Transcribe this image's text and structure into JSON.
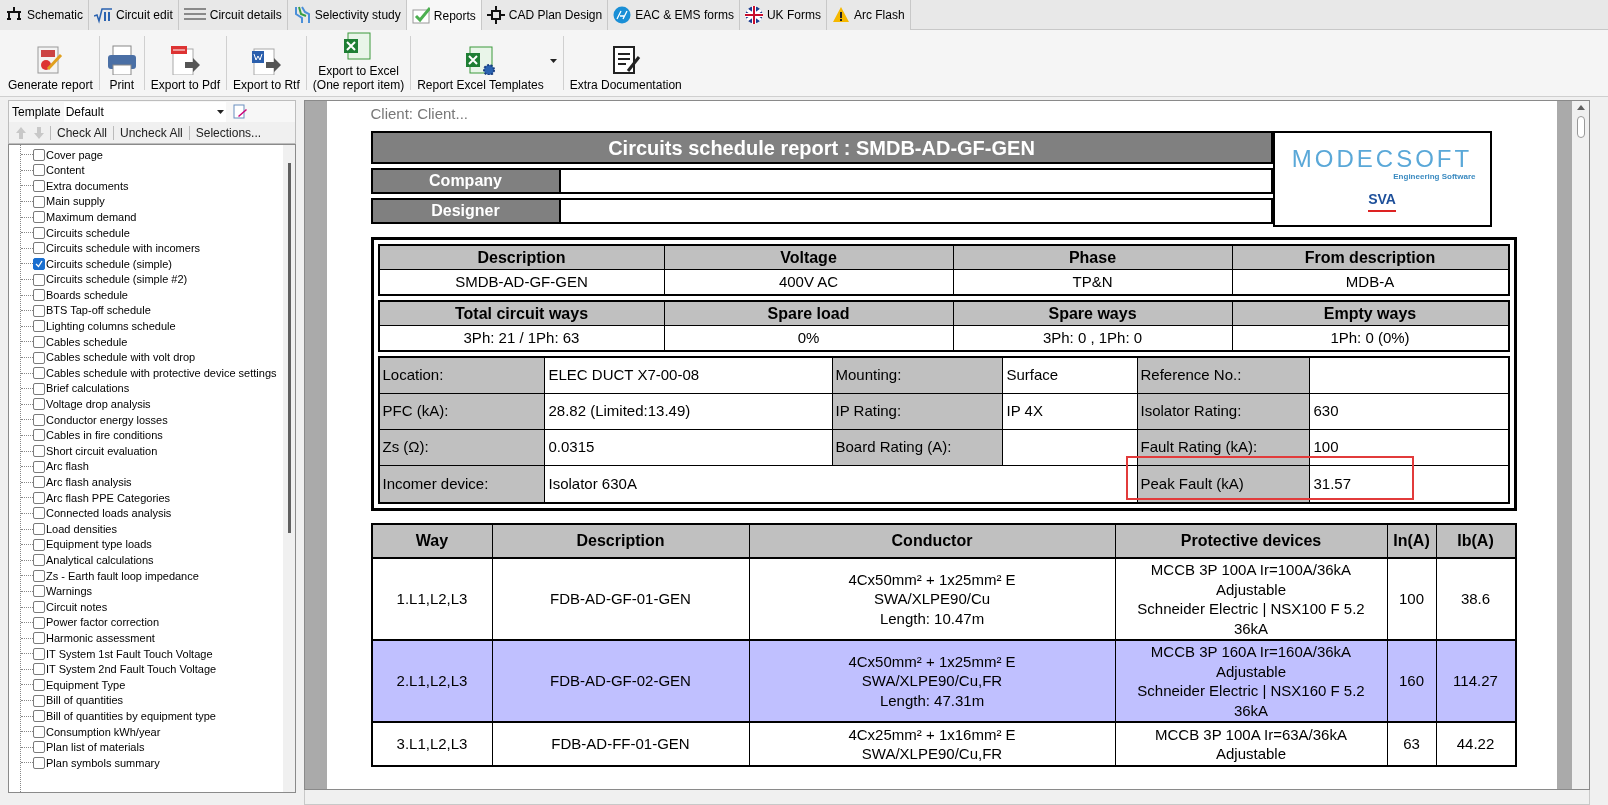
{
  "tabs": [
    {
      "label": "Schematic",
      "kind": "schematic",
      "selected": false
    },
    {
      "label": "Circuit edit",
      "kind": "formula",
      "selected": false
    },
    {
      "label": "Circuit details",
      "kind": "lines",
      "selected": false
    },
    {
      "label": "Selectivity study",
      "kind": "curves",
      "selected": false
    },
    {
      "label": "Reports",
      "kind": "check",
      "selected": true
    },
    {
      "label": "CAD Plan Design",
      "kind": "crosshair",
      "selected": false
    },
    {
      "label": "EAC & EMS forms",
      "kind": "badge",
      "selected": false
    },
    {
      "label": "UK Forms",
      "kind": "flag",
      "selected": false
    },
    {
      "label": "Arc Flash",
      "kind": "warning",
      "selected": false
    }
  ],
  "toolbar": [
    {
      "label": "Generate report",
      "kind": "report"
    },
    {
      "label": "Print",
      "kind": "print"
    },
    {
      "label": "Export to Pdf",
      "kind": "pdf"
    },
    {
      "label": "Export to Rtf",
      "kind": "rtf"
    },
    {
      "label": "Export to Excel\n(One report item)",
      "kind": "excel"
    },
    {
      "label": "Report Excel Templates",
      "kind": "excel-gear",
      "dropdown": true
    },
    {
      "label": "Extra Documentation",
      "kind": "document"
    }
  ],
  "sidebar": {
    "template_label": "Template",
    "template_value": "Default",
    "actions": [
      "Check All",
      "Uncheck All",
      "Selections..."
    ],
    "items": [
      {
        "label": "Cover page",
        "checked": false
      },
      {
        "label": "Content",
        "checked": false
      },
      {
        "label": "Extra documents",
        "checked": false
      },
      {
        "label": "Main supply",
        "checked": false
      },
      {
        "label": "Maximum demand",
        "checked": false
      },
      {
        "label": "Circuits schedule",
        "checked": false
      },
      {
        "label": "Circuits schedule with incomers",
        "checked": false
      },
      {
        "label": "Circuits schedule (simple)",
        "checked": true
      },
      {
        "label": "Circuits schedule (simple #2)",
        "checked": false
      },
      {
        "label": "Boards schedule",
        "checked": false
      },
      {
        "label": "BTS Tap-off schedule",
        "checked": false
      },
      {
        "label": "Lighting columns schedule",
        "checked": false
      },
      {
        "label": "Cables schedule",
        "checked": false
      },
      {
        "label": "Cables schedule with volt drop",
        "checked": false
      },
      {
        "label": "Cables schedule with protective device settings",
        "checked": false
      },
      {
        "label": "Brief calculations",
        "checked": false
      },
      {
        "label": "Voltage drop analysis",
        "checked": false
      },
      {
        "label": "Conductor energy losses",
        "checked": false
      },
      {
        "label": "Cables in fire conditions",
        "checked": false
      },
      {
        "label": "Short circuit evaluation",
        "checked": false
      },
      {
        "label": "Arc flash",
        "checked": false
      },
      {
        "label": "Arc flash analysis",
        "checked": false
      },
      {
        "label": "Arc flash PPE Categories",
        "checked": false
      },
      {
        "label": "Connected loads analysis",
        "checked": false
      },
      {
        "label": "Load densities",
        "checked": false
      },
      {
        "label": "Equipment type loads",
        "checked": false
      },
      {
        "label": "Analytical calculations",
        "checked": false
      },
      {
        "label": "Zs - Earth fault loop impedance",
        "checked": false
      },
      {
        "label": "Warnings",
        "checked": false
      },
      {
        "label": "Circuit notes",
        "checked": false
      },
      {
        "label": "Power factor correction",
        "checked": false
      },
      {
        "label": "Harmonic assessment",
        "checked": false
      },
      {
        "label": "IT System 1st Fault Touch Voltage",
        "checked": false
      },
      {
        "label": "IT System 2nd Fault Touch Voltage",
        "checked": false
      },
      {
        "label": "Equipment Type",
        "checked": false
      },
      {
        "label": "Bill of quantities",
        "checked": false
      },
      {
        "label": "Bill of quantities by equipment type",
        "checked": false
      },
      {
        "label": "Consumption kWh/year",
        "checked": false
      },
      {
        "label": "Plan list of materials",
        "checked": false
      },
      {
        "label": "Plan symbols summary",
        "checked": false
      }
    ]
  },
  "report": {
    "client": "Client: Client...",
    "title": "Circuits schedule report : SMDB-AD-GF-GEN",
    "company_label": "Company",
    "designer_label": "Designer",
    "logo": {
      "name": "MODECSOFT",
      "tagline": "Engineering Software",
      "badge": "SVA"
    },
    "summary": [
      {
        "headers": [
          "Description",
          "Voltage",
          "Phase",
          "From description"
        ],
        "values": [
          "SMDB-AD-GF-GEN",
          "400V AC",
          "TP&N",
          "MDB-A"
        ]
      },
      {
        "headers": [
          "Total circuit ways",
          "Spare load",
          "Spare ways",
          "Empty ways"
        ],
        "values": [
          "3Ph: 21 / 1Ph: 63",
          "0%",
          "3Ph: 0 , 1Ph: 0",
          "1Ph: 0 (0%)"
        ]
      }
    ],
    "details": [
      [
        {
          "label": "Location:",
          "value": "ELEC DUCT X7-00-08"
        },
        {
          "label": "Mounting:",
          "value": "Surface"
        },
        {
          "label": "Reference No.:"
        }
      ],
      [
        {
          "label": "PFC (kA):",
          "value": "28.82 (Limited:13.49)"
        },
        {
          "label": "IP Rating:",
          "value": "IP 4X"
        },
        {
          "label": "Isolator Rating:",
          "value": "630"
        }
      ],
      [
        {
          "label": "Zs (Ω):",
          "value": "0.0315"
        },
        {
          "label": "Board Rating (A):"
        },
        {
          "label": "Fault Rating (kA):",
          "value": "100"
        }
      ],
      [
        {
          "label": "Incomer device:",
          "value": "Isolator 630A",
          "wide": true
        },
        {
          "label": "Peak Fault (kA)",
          "value": "31.57",
          "highlighted": true
        }
      ]
    ],
    "circuits": {
      "columns": [
        "Way",
        "Description",
        "Conductor",
        "Protective devices",
        "In(A)",
        "Ib(A)"
      ],
      "rows": [
        {
          "selected": false,
          "cells": [
            "1.L1,L2,L3",
            "FDB-AD-GF-01-GEN",
            "4Cx50mm² + 1x25mm² E\nSWA/XLPE90/Cu\nLength: 10.47m",
            "MCCB 3P 100A Ir=100A/36kA\nAdjustable\nSchneider Electric | NSX100 F 5.2\n36kA",
            "100",
            "38.6"
          ]
        },
        {
          "selected": true,
          "cells": [
            "2.L1,L2,L3",
            "FDB-AD-GF-02-GEN",
            "4Cx50mm² + 1x25mm² E\nSWA/XLPE90/Cu,FR\nLength: 47.31m",
            "MCCB 3P 160A Ir=160A/36kA\nAdjustable\nSchneider Electric | NSX160 F 5.2\n36kA",
            "160",
            "114.27"
          ]
        },
        {
          "selected": false,
          "cells": [
            "3.L1,L2,L3",
            "FDB-AD-FF-01-GEN",
            "4Cx25mm² + 1x16mm² E\nSWA/XLPE90/Cu,FR",
            "MCCB 3P 100A Ir=63A/36kA\nAdjustable",
            "63",
            "44.22"
          ]
        }
      ]
    }
  }
}
